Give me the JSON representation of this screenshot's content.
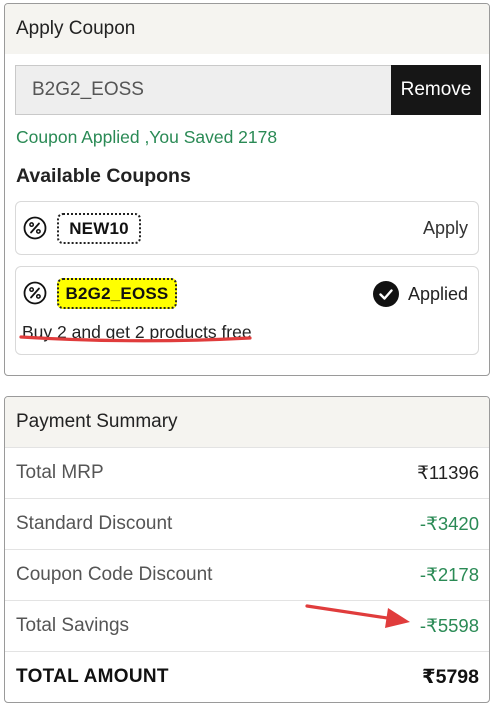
{
  "apply_coupon": {
    "title": "Apply Coupon",
    "input_value": "B2G2_EOSS",
    "remove_label": "Remove",
    "saved_message": "Coupon Applied ,You Saved 2178"
  },
  "available_coupons": {
    "title": "Available Coupons",
    "items": [
      {
        "code": "NEW10",
        "action": "Apply",
        "icon": "percent-badge-icon"
      },
      {
        "code": "B2G2_EOSS",
        "status": "Applied",
        "description": "Buy 2 and get 2 products free",
        "icon": "percent-badge-icon",
        "highlight_color": "#ffff00"
      }
    ]
  },
  "payment_summary": {
    "title": "Payment Summary",
    "rows": [
      {
        "label": "Total MRP",
        "value": "₹11396"
      },
      {
        "label": "Standard Discount",
        "value": "-₹3420"
      },
      {
        "label": "Coupon Code Discount",
        "value": "-₹2178"
      },
      {
        "label": "Total Savings",
        "value": "-₹5598"
      }
    ],
    "total": {
      "label": "TOTAL AMOUNT",
      "value": "₹5798"
    }
  },
  "colors": {
    "savings_green": "#2a8a55",
    "annotation_red": "#e03c3c",
    "header_bg": "#f5f4f0",
    "button_bg": "#161616"
  }
}
